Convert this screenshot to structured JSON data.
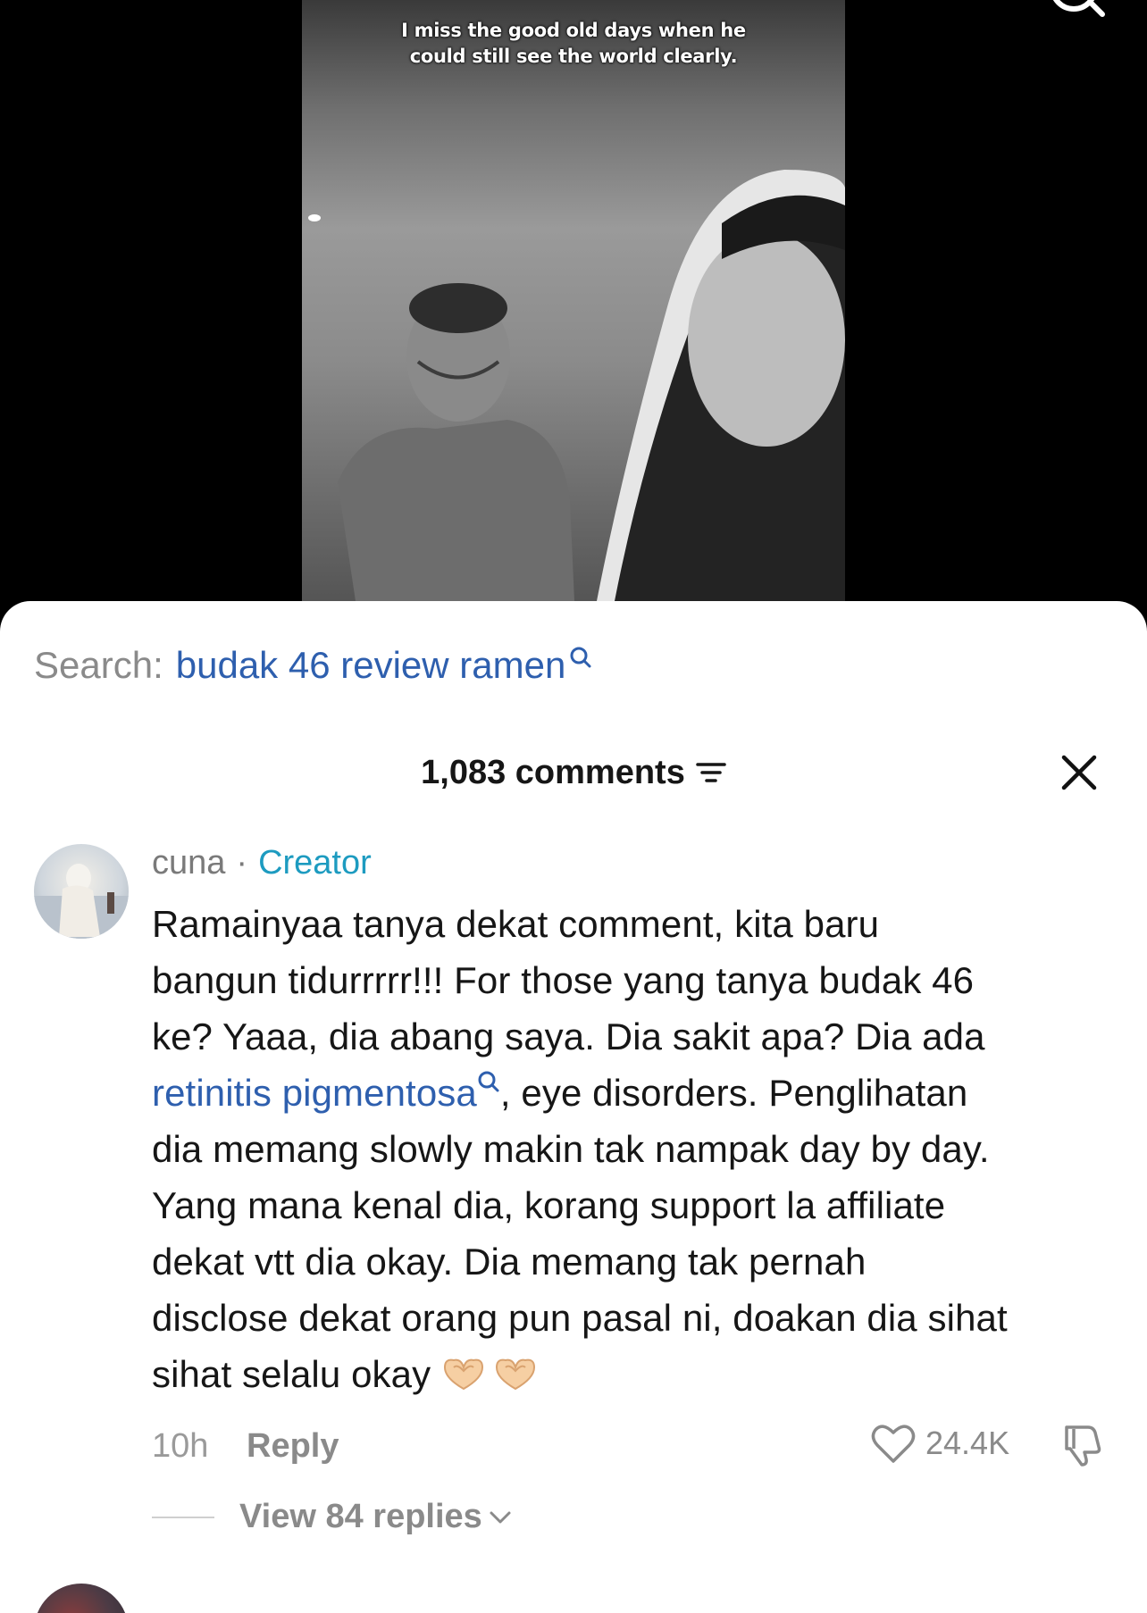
{
  "video": {
    "caption_line1": "I miss the good old days when he",
    "caption_line2": "could still see the world clearly.",
    "search_icon": "search-icon"
  },
  "search": {
    "label": "Search:",
    "query": "budak 46 review ramen",
    "icon": "search-icon"
  },
  "comments": {
    "title": "1,083 comments",
    "filter_icon": "filter-icon",
    "close_icon": "close-icon"
  },
  "comment": {
    "username": "cuna",
    "separator": "·",
    "badge": "Creator",
    "lines": [
      "Ramainyaa tanya dekat comment, kita baru",
      "bangun tidurrrrr!!! For those yang tanya budak 46",
      "ke? Yaaa, dia abang saya. Dia sakit apa? Dia ada",
      "dia memang slowly makin tak nampak day by day.",
      "Yang mana kenal dia, korang support la affiliate",
      "dekat vtt dia okay. Dia memang tak pernah",
      "disclose dekat orang pun pasal ni, doakan dia sihat",
      "sihat selalu okay"
    ],
    "link_text": "retinitis pigmentosa",
    "link_suffix": ", eye disorders. Penglihatan",
    "emoji": "heart-hands-emoji",
    "time": "10h",
    "reply_label": "Reply",
    "likes": "24.4K",
    "view_replies": "View 84 replies"
  },
  "colors": {
    "link": "#2e5fae",
    "creator_badge": "#1d9bc0",
    "muted": "#8a8a8a"
  }
}
